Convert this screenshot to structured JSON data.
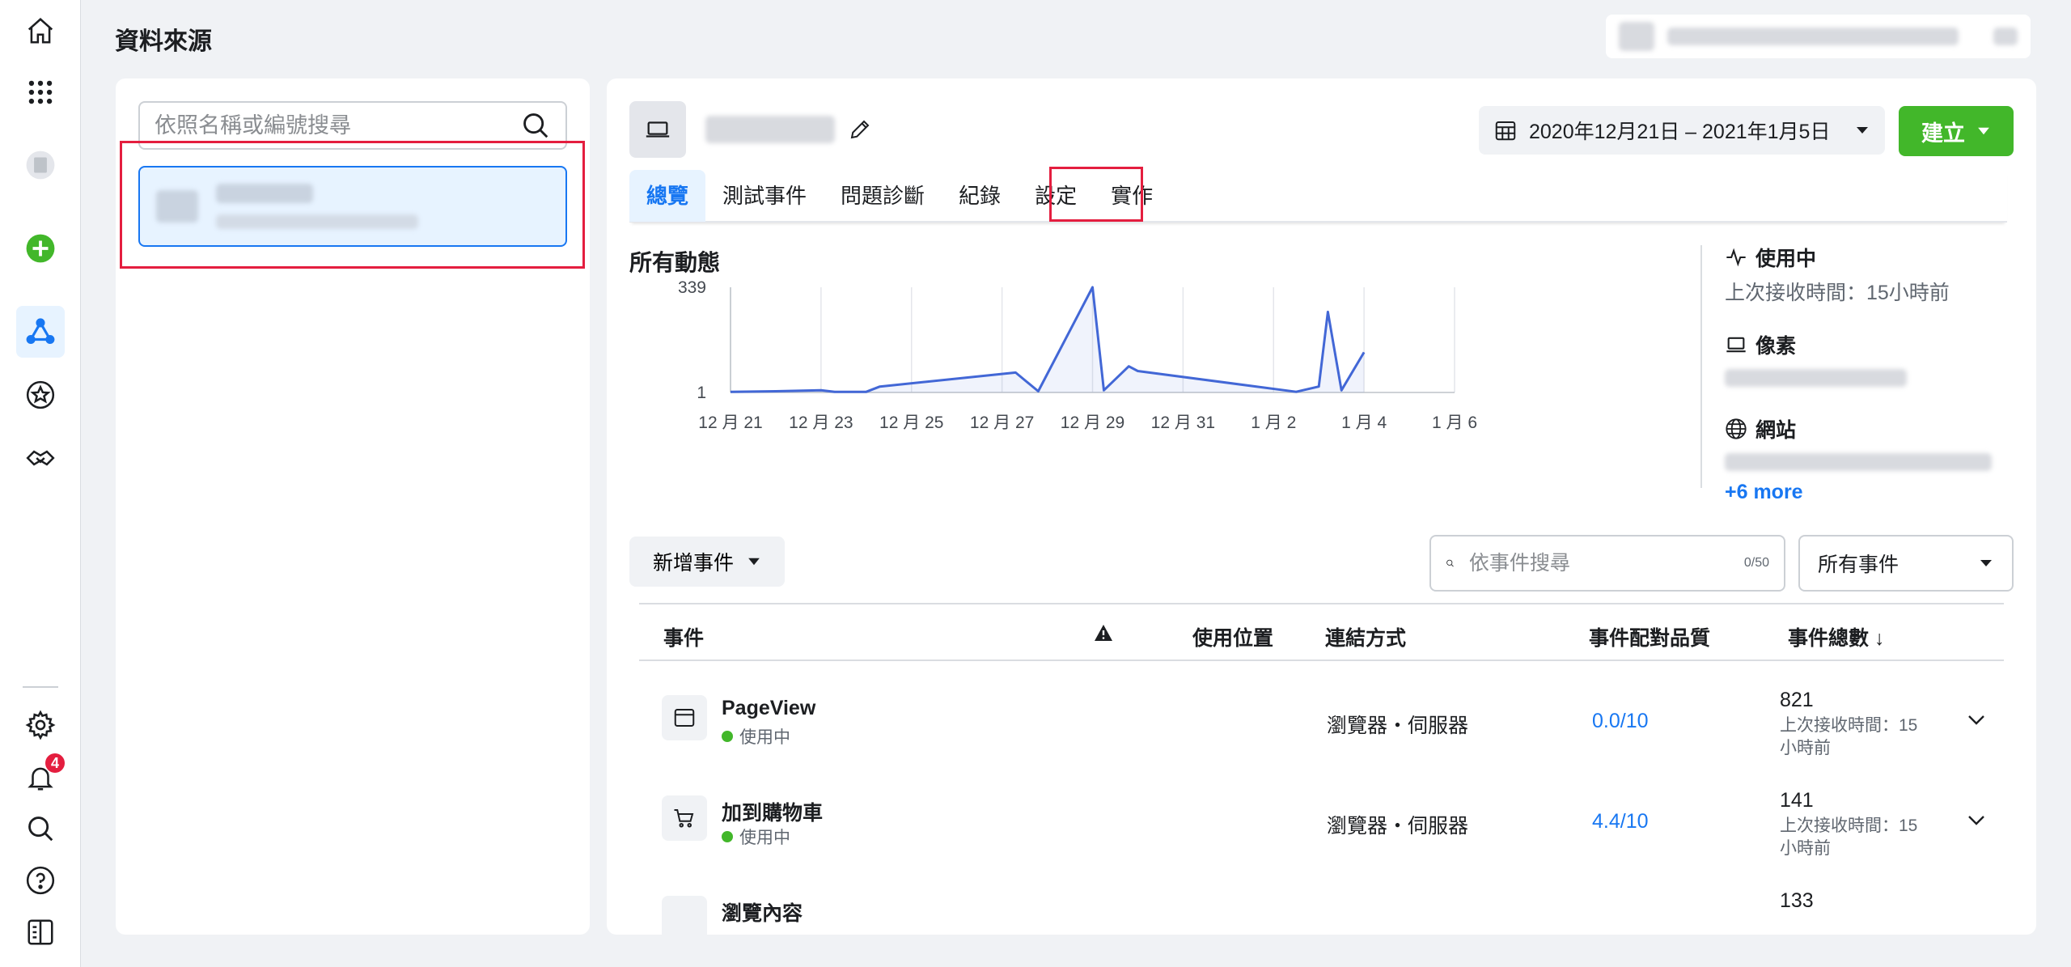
{
  "page": {
    "title": "資料來源"
  },
  "sidebar": {
    "notification_count": "4"
  },
  "left_panel": {
    "search_placeholder": "依照名稱或編號搜尋"
  },
  "tabs": [
    {
      "label": "總覽"
    },
    {
      "label": "測試事件"
    },
    {
      "label": "問題診斷"
    },
    {
      "label": "紀錄"
    },
    {
      "label": "設定"
    },
    {
      "label": "實作"
    }
  ],
  "date_range": "2020年12月21日 – 2021年1月5日",
  "create_button": "建立",
  "activity": {
    "title": "所有動態"
  },
  "chart_data": {
    "type": "area",
    "title": "所有動態",
    "x_ticks": [
      "12 月 21",
      "12 月 23",
      "12 月 25",
      "12 月 27",
      "12 月 29",
      "12 月 31",
      "1 月 2",
      "1 月 4",
      "1 月 6"
    ],
    "y_ticks": [
      "339",
      "1"
    ],
    "ylim": [
      1,
      339
    ],
    "xlim": [
      0,
      16
    ],
    "series": [
      {
        "x": [
          0,
          1,
          2,
          2.3,
          3,
          3.3,
          6.3,
          6.8,
          8.0,
          8.25,
          8.8,
          9.0,
          12.5,
          13.0,
          13.2,
          13.5,
          14.0
        ],
        "y": [
          3,
          5,
          8,
          3,
          3,
          20,
          65,
          5,
          339,
          8,
          85,
          70,
          3,
          20,
          260,
          8,
          130
        ]
      }
    ],
    "color": "#4267d6",
    "grid": true
  },
  "status": {
    "heading": "使用中",
    "last_received": "上次接收時間：15小時前",
    "pixel_label": "像素",
    "website_label": "網站",
    "more_link": "+6 more"
  },
  "events": {
    "add_button": "新增事件",
    "search_placeholder": "依事件搜尋",
    "search_count": "0/50",
    "filter_value": "所有事件",
    "columns": [
      "事件",
      "使用位置",
      "連結方式",
      "事件配對品質",
      "事件總數 ↓"
    ],
    "rows": [
      {
        "name": "PageView",
        "status": "使用中",
        "connection": "瀏覽器・伺服器",
        "quality": "0.0/10",
        "total": "821",
        "total_sub": "上次接收時間：15小時前"
      },
      {
        "name": "加到購物車",
        "status": "使用中",
        "connection": "瀏覽器・伺服器",
        "quality": "4.4/10",
        "total": "141",
        "total_sub": "上次接收時間：15小時前"
      },
      {
        "name": "瀏覽內容",
        "total": "133"
      }
    ]
  }
}
